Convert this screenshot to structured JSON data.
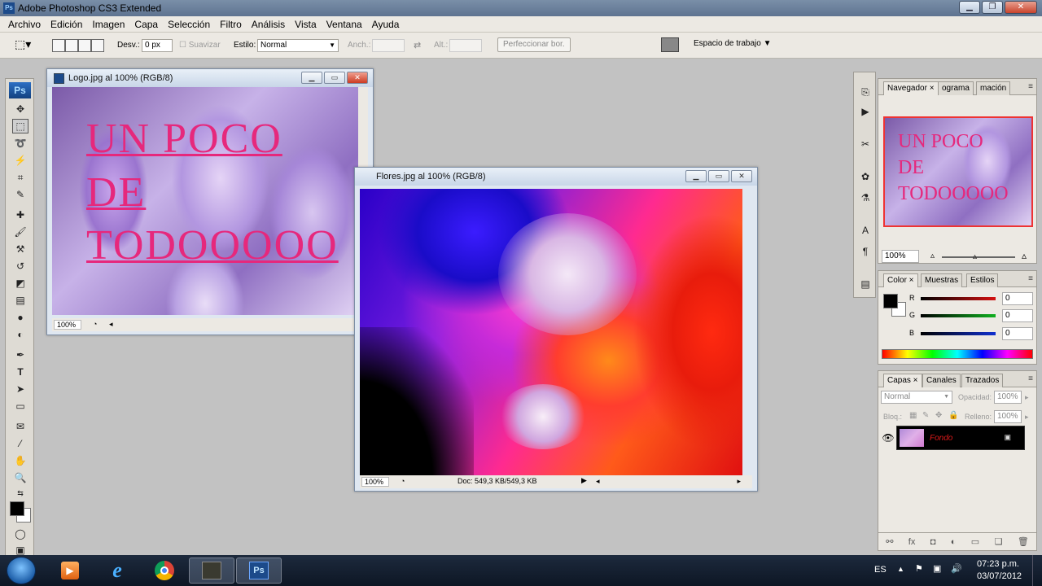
{
  "app": {
    "title": "Adobe Photoshop CS3 Extended",
    "ps_badge": "Ps"
  },
  "menu": [
    "Archivo",
    "Edición",
    "Imagen",
    "Capa",
    "Selección",
    "Filtro",
    "Análisis",
    "Vista",
    "Ventana",
    "Ayuda"
  ],
  "options": {
    "desv_label": "Desv.:",
    "desv_value": "0 px",
    "suavizar_label": "Suavizar",
    "estilo_label": "Estilo:",
    "estilo_value": "Normal",
    "anch_label": "Anch.:",
    "alt_label": "Alt.:",
    "refine_button": "Perfeccionar bor.",
    "workspace_label": "Espacio de trabajo"
  },
  "toolbox": {
    "logo": "Ps"
  },
  "windows": {
    "logo": {
      "title": "Logo.jpg al 100% (RGB/8)",
      "zoom": "100%",
      "lines": [
        "UN POCO",
        "DE",
        "TODOOOOO"
      ]
    },
    "flores": {
      "title": "Flores.jpg al 100% (RGB/8)",
      "zoom": "100%",
      "doc_info": "Doc: 549,3 KB/549,3 KB"
    }
  },
  "navigator": {
    "tabs": [
      "Navegador",
      "ograma",
      "mación"
    ],
    "zoom": "100%",
    "thumb_lines": [
      "UN POCO",
      "DE",
      "TODOOOOO"
    ]
  },
  "color_panel": {
    "tabs": [
      "Color",
      "Muestras",
      "Estilos"
    ],
    "channels": [
      {
        "label": "R",
        "value": "0",
        "color": "#d41010"
      },
      {
        "label": "G",
        "value": "0",
        "color": "#10b020"
      },
      {
        "label": "B",
        "value": "0",
        "color": "#1030d0"
      }
    ]
  },
  "layers_panel": {
    "tabs": [
      "Capas",
      "Canales",
      "Trazados"
    ],
    "blend_mode": "Normal",
    "opacity_label": "Opacidad:",
    "opacity_value": "100%",
    "lock_label": "Bloq.:",
    "fill_label": "Relleno:",
    "fill_value": "100%",
    "layers": [
      {
        "name": "Fondo"
      }
    ]
  },
  "taskbar": {
    "language": "ES",
    "time": "07:23 p.m.",
    "date": "03/07/2012",
    "ps_label": "Ps"
  },
  "colors": {
    "accent_pink": "#e6287c",
    "title_blue": "#5e7390"
  }
}
